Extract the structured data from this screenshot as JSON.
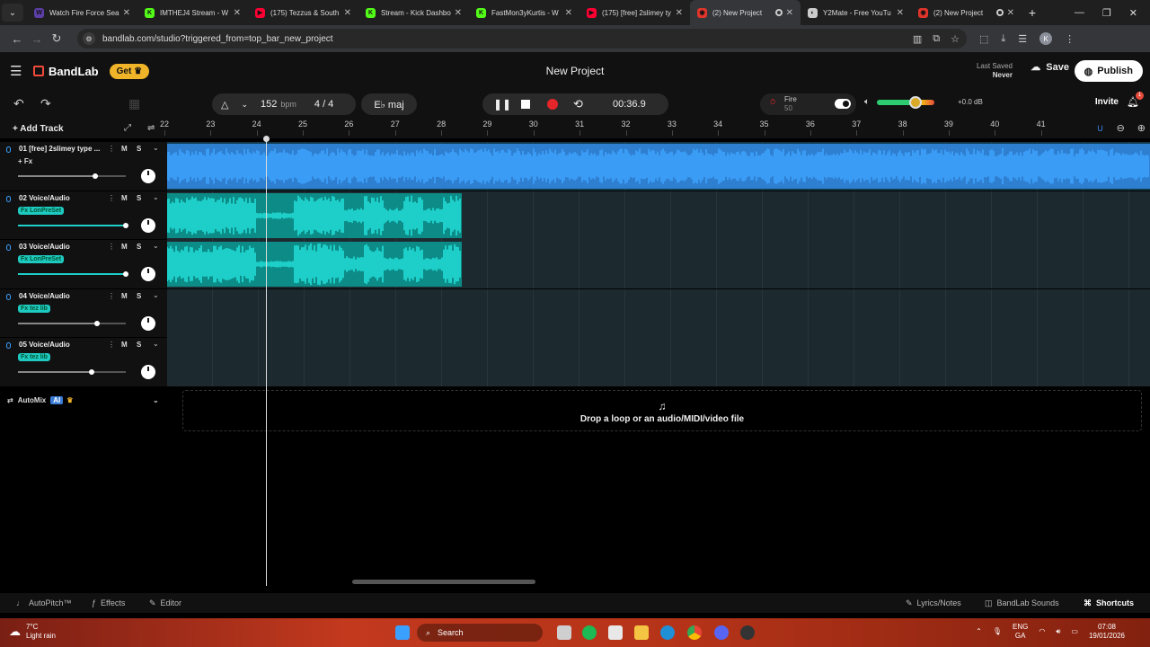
{
  "browser": {
    "tabs": [
      {
        "title": "Watch Fire Force Sea",
        "color": "#5b3fa6",
        "glyph": "W",
        "active": false,
        "close": "✕"
      },
      {
        "title": "IMTHEJ4 Stream - W",
        "color": "#53fc18",
        "glyph": "K",
        "active": false,
        "close": "✕"
      },
      {
        "title": "(175) Tezzus & South",
        "color": "#ff0033",
        "glyph": "▶",
        "active": false,
        "close": "✕"
      },
      {
        "title": "Stream - Kick Dashbo",
        "color": "#53fc18",
        "glyph": "K",
        "active": false,
        "close": "✕"
      },
      {
        "title": "FastMon3yKurtis - W",
        "color": "#53fc18",
        "glyph": "K",
        "active": false,
        "close": "✕"
      },
      {
        "title": "(175) [free] 2slimey ty",
        "color": "#ff0033",
        "glyph": "▶",
        "active": false,
        "close": "✕"
      },
      {
        "title": "(2) New Project",
        "color": "#e0352b",
        "glyph": "◉",
        "active": true,
        "close": "✕"
      },
      {
        "title": "Y2Mate - Free YouTu",
        "color": "#cccccc",
        "glyph": "◐",
        "active": false,
        "close": "✕"
      },
      {
        "title": "(2) New Project",
        "color": "#e0352b",
        "glyph": "◉",
        "active": false,
        "close": "✕"
      }
    ],
    "url": "bandlab.com/studio?triggered_from=top_bar_new_project",
    "profile_initial": "K"
  },
  "header": {
    "brand": "BandLab",
    "get_label": "Get",
    "project_title": "New Project",
    "last_saved_label": "Last Saved",
    "last_saved_value": "Never",
    "save_label": "Save",
    "publish_label": "Publish"
  },
  "transport": {
    "bpm_value": "152",
    "bpm_unit": "bpm",
    "time_signature": "4 / 4",
    "key": "E♭ maj",
    "time_display": "00:36.9",
    "fire_label": "Fire",
    "fire_value": "50",
    "volume_db": "+0.0 dB",
    "invite_label": "Invite",
    "notification_count": "1"
  },
  "toolbar": {
    "add_track_label": "Add Track"
  },
  "ruler": {
    "marks": [
      "22",
      "23",
      "24",
      "25",
      "26",
      "27",
      "28",
      "29",
      "30",
      "31",
      "32",
      "33",
      "34",
      "35",
      "36",
      "37",
      "38",
      "39",
      "40",
      "41"
    ]
  },
  "tracks": [
    {
      "number": "01",
      "name": "[free] 2slimey type ...",
      "fx": "+ Fx",
      "fx_plain": true,
      "volume": 0.72,
      "color": "#3a9cf5",
      "mute": "M",
      "solo": "S"
    },
    {
      "number": "02",
      "name": "Voice/Audio",
      "fx": "Fx LonPreSet",
      "fx_plain": false,
      "volume": 1.0,
      "color": "#1ecfc9",
      "mute": "M",
      "solo": "S"
    },
    {
      "number": "03",
      "name": "Voice/Audio",
      "fx": "Fx LonPreSet",
      "fx_plain": false,
      "volume": 1.0,
      "color": "#1ecfc9",
      "mute": "M",
      "solo": "S"
    },
    {
      "number": "04",
      "name": "Voice/Audio",
      "fx": "Fx tez lib",
      "fx_plain": false,
      "volume": 0.73,
      "color": "#1ecfc9",
      "mute": "M",
      "solo": "S"
    },
    {
      "number": "05",
      "name": "Voice/Audio",
      "fx": "Fx tez lib",
      "fx_plain": false,
      "volume": 0.68,
      "color": "#1ecfc9",
      "mute": "M",
      "solo": "S"
    }
  ],
  "automix": {
    "label": "AutoMix",
    "badge": "AI"
  },
  "drop_zone": {
    "text": "Drop a loop or an audio/MIDI/video file"
  },
  "footer": {
    "autopitch": "AutoPitch™",
    "effects": "Effects",
    "editor": "Editor",
    "lyrics": "Lyrics/Notes",
    "sounds": "BandLab Sounds",
    "shortcuts": "Shortcuts"
  },
  "taskbar": {
    "temperature": "7°C",
    "weather": "Light rain",
    "search": "Search",
    "language": "ENG",
    "region": "GA",
    "time": "07:08",
    "date": "19/01/2026"
  }
}
